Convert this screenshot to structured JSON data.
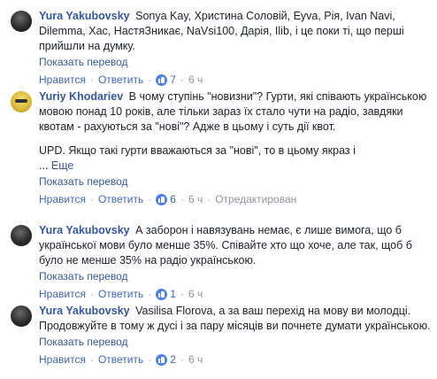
{
  "comments": [
    {
      "author": "Yura Yakubovsky",
      "text": "Sonya Kay, Христина Соловій, Eyva, Рія, Ivan Navi, Dilemma, Хас, НастяЗникає, NaVsi100, Дарія, Ilib, і це поки ті, що перші прийшли на думку.",
      "translate": "Показать перевод",
      "like": "Нравится",
      "reply": "Ответить",
      "likes": "7",
      "time": "6 ч",
      "avatar": "dark"
    },
    {
      "author": "Yuriy Khodariev",
      "text": "В чому ступінь \"новизни\"? Гурти, які співають українською мовою понад 10 років, але тільки зараз їх стало чути на радіо, завдяки квотам - рахуються за \"нові\"? Адже в цьому і суть дії квот.",
      "text2": "UPD. Якщо такі гурти вважаються за \"нові\", то в цьому якраз і",
      "more_prefix": "... ",
      "more": "Еще",
      "translate": "Показать перевод",
      "like": "Нравится",
      "reply": "Ответить",
      "likes": "6",
      "time": "6 ч",
      "edited": "Отредактирован",
      "avatar": "yellow"
    },
    {
      "author": "Yura Yakubovsky",
      "text": "А заборон і навязувань немає, є лише вимога, що б української мови було менше 35%. Співайте хто що хоче, але так, щоб б було не менше 35% на радіо українською.",
      "translate": "Показать перевод",
      "like": "Нравится",
      "reply": "Ответить",
      "likes": "1",
      "time": "6 ч",
      "avatar": "dark"
    },
    {
      "author": "Yura Yakubovsky",
      "text": "Vasilisa Florova, а за ваш перехід на мову ви молодці. Продовжуйте в тому ж дусі і за пару місяців ви почнете думати українською.",
      "translate": "Показать перевод",
      "like": "Нравится",
      "reply": "Ответить",
      "likes": "2",
      "time": "6 ч",
      "avatar": "dark"
    }
  ],
  "separator": "·",
  "colors": {
    "link": "#365899",
    "meta": "#90949c",
    "like_badge": "#4f7fe8"
  }
}
